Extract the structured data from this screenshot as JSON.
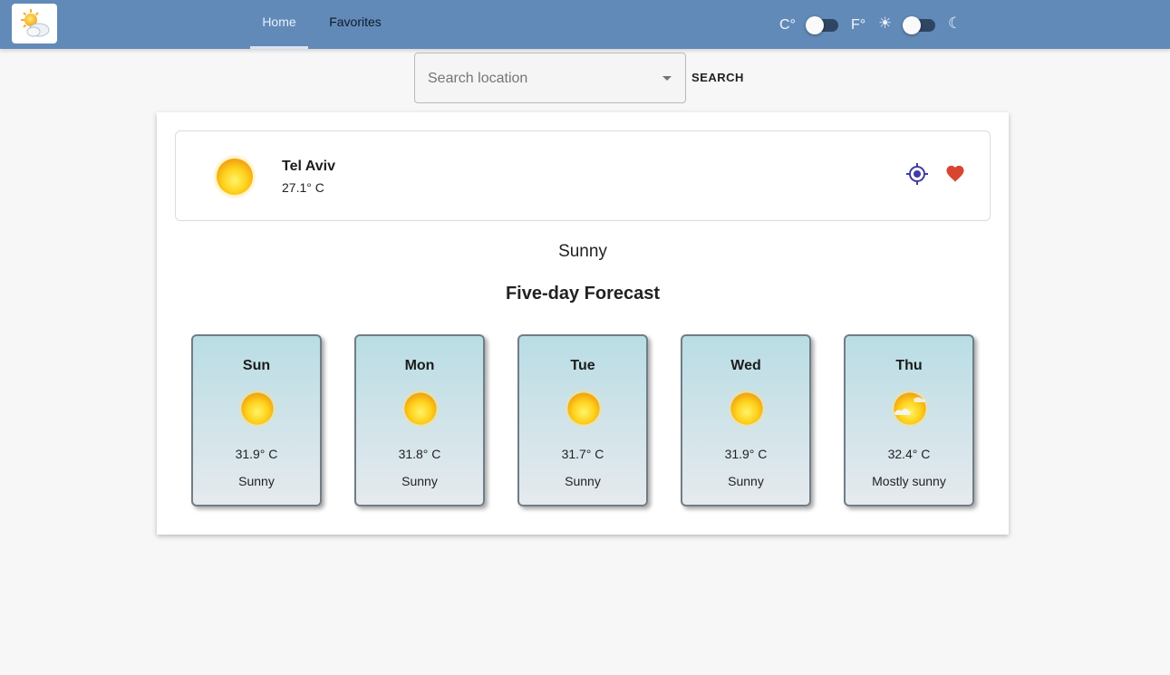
{
  "nav": {
    "home": "Home",
    "favorites": "Favorites",
    "celsius": "C°",
    "fahrenheit": "F°",
    "sun_glyph": "☀",
    "moon_glyph": "☾",
    "unit_toggle_on": false,
    "theme_toggle_on": false
  },
  "search": {
    "placeholder": "Search location",
    "value": "",
    "button": "SEARCH"
  },
  "current": {
    "city": "Tel Aviv",
    "temperature": "27.1° C",
    "condition": "Sunny",
    "icon": "sun-icon",
    "is_favorite": true
  },
  "forecast": {
    "title": "Five-day Forecast",
    "days": [
      {
        "day": "Sun",
        "temp": "31.9° C",
        "condition": "Sunny",
        "icon": "sun-icon"
      },
      {
        "day": "Mon",
        "temp": "31.8° C",
        "condition": "Sunny",
        "icon": "sun-icon"
      },
      {
        "day": "Tue",
        "temp": "31.7° C",
        "condition": "Sunny",
        "icon": "sun-icon"
      },
      {
        "day": "Wed",
        "temp": "31.9° C",
        "condition": "Sunny",
        "icon": "sun-icon"
      },
      {
        "day": "Thu",
        "temp": "32.4° C",
        "condition": "Mostly sunny",
        "icon": "mostly-sunny-icon"
      }
    ]
  },
  "colors": {
    "appbar": "#628ab8",
    "locate": "#3f3ca3",
    "heart": "#d9462f"
  }
}
